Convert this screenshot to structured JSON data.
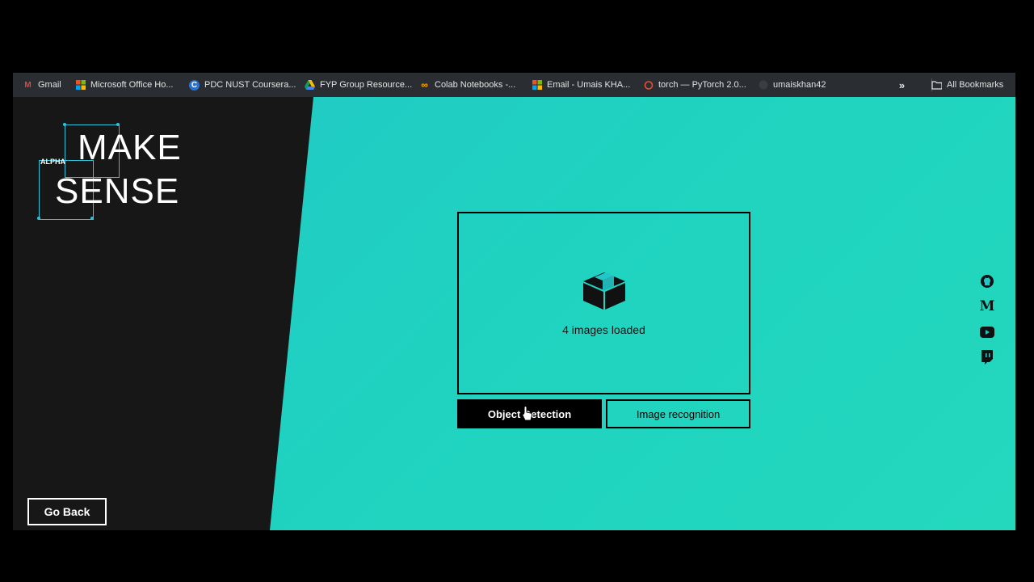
{
  "bookmarks": {
    "items": [
      {
        "label": "Gmail",
        "icon": "gmail-icon"
      },
      {
        "label": "Microsoft Office Ho...",
        "icon": "microsoft-icon"
      },
      {
        "label": "PDC NUST Coursera...",
        "icon": "coursera-icon"
      },
      {
        "label": "FYP Group Resource...",
        "icon": "google-drive-icon"
      },
      {
        "label": "Colab Notebooks -...",
        "icon": "colab-icon"
      },
      {
        "label": "Email - Umais KHA...",
        "icon": "microsoft-icon"
      },
      {
        "label": "torch — PyTorch 2.0...",
        "icon": "pytorch-icon"
      },
      {
        "label": "umaiskhan42",
        "icon": "github-icon"
      }
    ],
    "all_bookmarks_label": "All Bookmarks"
  },
  "logo": {
    "alpha": "ALPHA",
    "line1": "MAKE",
    "line2": "SENSE"
  },
  "dropzone": {
    "message": "4 images loaded",
    "icon": "box-icon"
  },
  "buttons": {
    "object_detection": "Object Detection",
    "image_recognition": "Image recognition",
    "go_back": "Go Back"
  },
  "socials": [
    "github-icon",
    "medium-icon",
    "youtube-icon",
    "twitch-icon"
  ],
  "colors": {
    "teal": "#22c6c6",
    "dark": "#171717",
    "accent": "#2fc4d9"
  }
}
